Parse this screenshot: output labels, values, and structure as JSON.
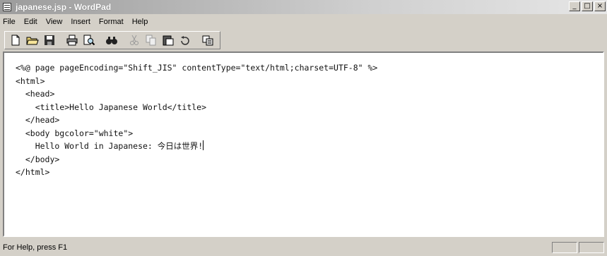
{
  "window": {
    "title": "japanese.jsp - WordPad"
  },
  "controls": {
    "minimize": "_",
    "maximize": "□",
    "close": "×"
  },
  "menu": [
    "File",
    "Edit",
    "View",
    "Insert",
    "Format",
    "Help"
  ],
  "toolbar": {
    "icons": [
      "new-icon",
      "open-icon",
      "save-icon",
      "print-icon",
      "print-preview-icon",
      "find-icon",
      "cut-icon",
      "copy-icon",
      "paste-icon",
      "undo-icon",
      "insert-datetime-icon"
    ]
  },
  "document": {
    "lines": [
      "<%@ page pageEncoding=\"Shift_JIS\" contentType=\"text/html;charset=UTF-8\" %>",
      "<html>",
      "  <head>",
      "    <title>Hello Japanese World</title>",
      "  </head>",
      "  <body bgcolor=\"white\">",
      "    Hello World in Japanese: 今日は世界!",
      "  </body>",
      "</html>"
    ]
  },
  "status": {
    "text": "For Help, press F1"
  }
}
